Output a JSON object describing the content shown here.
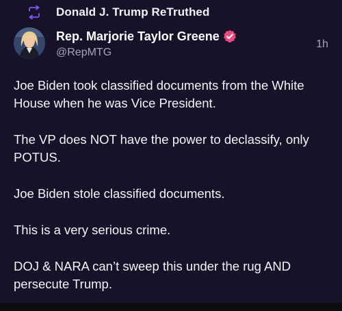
{
  "retruth": {
    "label": "Donald J. Trump ReTruthed",
    "icon": "retruth-icon"
  },
  "author": {
    "display_name": "Rep. Marjorie Taylor Greene",
    "handle": "@RepMTG",
    "verified": true,
    "verified_icon": "verified-badge-icon"
  },
  "post": {
    "timestamp": "1h",
    "paragraphs": [
      "Joe Biden took classified documents from the White House when he was Vice President.",
      "The VP does NOT have the power to declassify, only POTUS.",
      "Joe Biden stole classified documents.",
      "This is a very serious crime.",
      "DOJ & NARA can’t sweep this under the rug AND persecute Trump."
    ]
  },
  "colors": {
    "background": "#17122a",
    "accent": "#e8497f",
    "retruth_icon": "#7a5cf2"
  }
}
